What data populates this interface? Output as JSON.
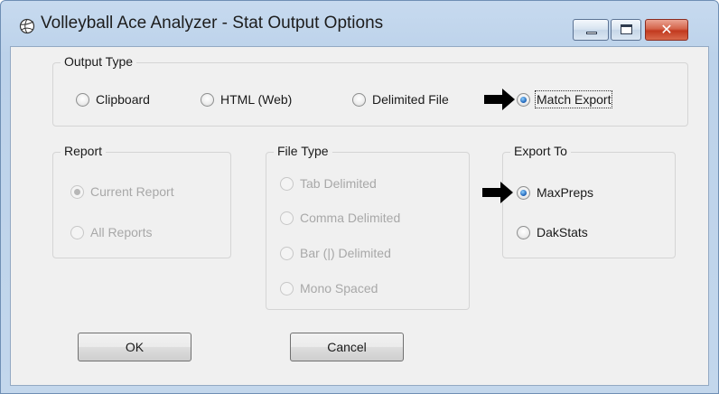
{
  "window": {
    "title": "Volleyball Ace Analyzer - Stat Output Options",
    "icon": "volleyball-app-icon",
    "controls": {
      "minimize": "minimize-icon",
      "maximize": "maximize-icon",
      "close": "close-icon",
      "close_glyph": "✕"
    }
  },
  "output_type": {
    "title": "Output Type",
    "options": [
      {
        "label": "Clipboard",
        "checked": false
      },
      {
        "label": "HTML (Web)",
        "checked": false
      },
      {
        "label": "Delimited File",
        "checked": false
      },
      {
        "label": "Match Export",
        "checked": true
      }
    ]
  },
  "report": {
    "title": "Report",
    "enabled": false,
    "options": [
      {
        "label": "Current Report",
        "checked": true
      },
      {
        "label": "All Reports",
        "checked": false
      }
    ]
  },
  "file_type": {
    "title": "File Type",
    "enabled": false,
    "options": [
      {
        "label": "Tab Delimited",
        "checked": false
      },
      {
        "label": "Comma Delimited",
        "checked": false
      },
      {
        "label": "Bar (|) Delimited",
        "checked": false
      },
      {
        "label": "Mono Spaced",
        "checked": false
      }
    ]
  },
  "export_to": {
    "title": "Export To",
    "options": [
      {
        "label": "MaxPreps",
        "checked": true
      },
      {
        "label": "DakStats",
        "checked": false
      }
    ]
  },
  "buttons": {
    "ok": "OK",
    "cancel": "Cancel"
  },
  "annotations": {
    "arrow_icon": "black-right-arrow-icon",
    "arrow_color": "#000000"
  }
}
